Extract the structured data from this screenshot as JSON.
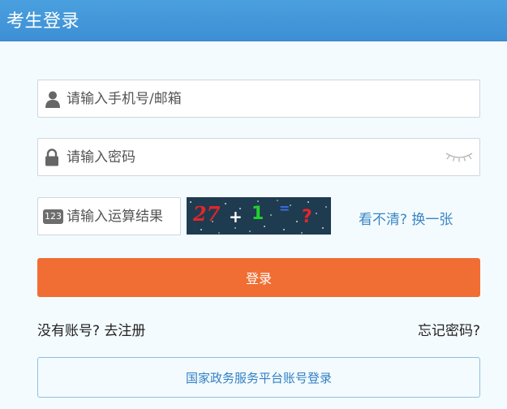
{
  "header": {
    "title": "考生登录"
  },
  "form": {
    "account_placeholder": "请输入手机号/邮箱",
    "password_placeholder": "请输入密码",
    "captcha_placeholder": "请输入运算结果",
    "captcha_icon_text": "123",
    "captcha_image": {
      "tokens": [
        "27",
        "+",
        "1",
        "=",
        "?"
      ],
      "token_colors": [
        "#e3262b",
        "#ffffff",
        "#22d12c",
        "#3a6fe0",
        "#e3262b"
      ]
    },
    "refresh_link": "看不清? 换一张"
  },
  "actions": {
    "login_button": "登录",
    "register_link": "没有账号? 去注册",
    "forgot_link": "忘记密码?",
    "gov_login_button": "国家政务服务平台账号登录"
  },
  "colors": {
    "header_bg": "#4297d9",
    "primary_button": "#f06e33",
    "link": "#3a86c6",
    "page_bg": "#f4fbfe"
  },
  "icons": {
    "account": "user-icon",
    "password": "lock-icon",
    "toggle_password": "eye-closed-icon",
    "captcha": "number-123-icon"
  }
}
